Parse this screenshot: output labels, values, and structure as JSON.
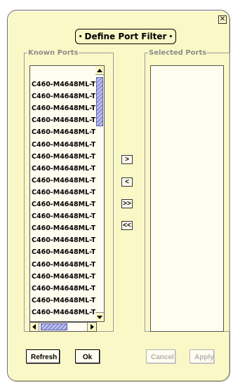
{
  "dialog": {
    "title": "Define Port Filter",
    "close_icon": "close-icon"
  },
  "known_ports": {
    "label": "Known Ports",
    "items": [
      "C460-M4648ML-T",
      "C460-M4648ML-T",
      "C460-M4648ML-T",
      "C460-M4648ML-T",
      "C460-M4648ML-T",
      "C460-M4648ML-T",
      "C460-M4648ML-T",
      "C460-M4648ML-T",
      "C460-M4648ML-T",
      "C460-M4648ML-T",
      "C460-M4648ML-T",
      "C460-M4648ML-T",
      "C460-M4648ML-T",
      "C460-M4648ML-T",
      "C460-M4648ML-T",
      "C460-M4648ML-T",
      "C460-M4648ML-T",
      "C460-M4648ML-T",
      "C460-M4648ML-T",
      "C460-M4648ML-T"
    ]
  },
  "selected_ports": {
    "label": "Selected Ports",
    "items": []
  },
  "move_buttons": {
    "add": ">",
    "remove": "<",
    "add_all": ">>",
    "remove_all": "<<"
  },
  "buttons": {
    "refresh": "Refresh",
    "ok": "Ok",
    "cancel": "Cancel",
    "apply": "Apply"
  },
  "colors": {
    "dialog_bg": "#fbf8c7",
    "scroll_thumb": "#8a8fd6",
    "disabled_text": "#b0b0b0"
  }
}
